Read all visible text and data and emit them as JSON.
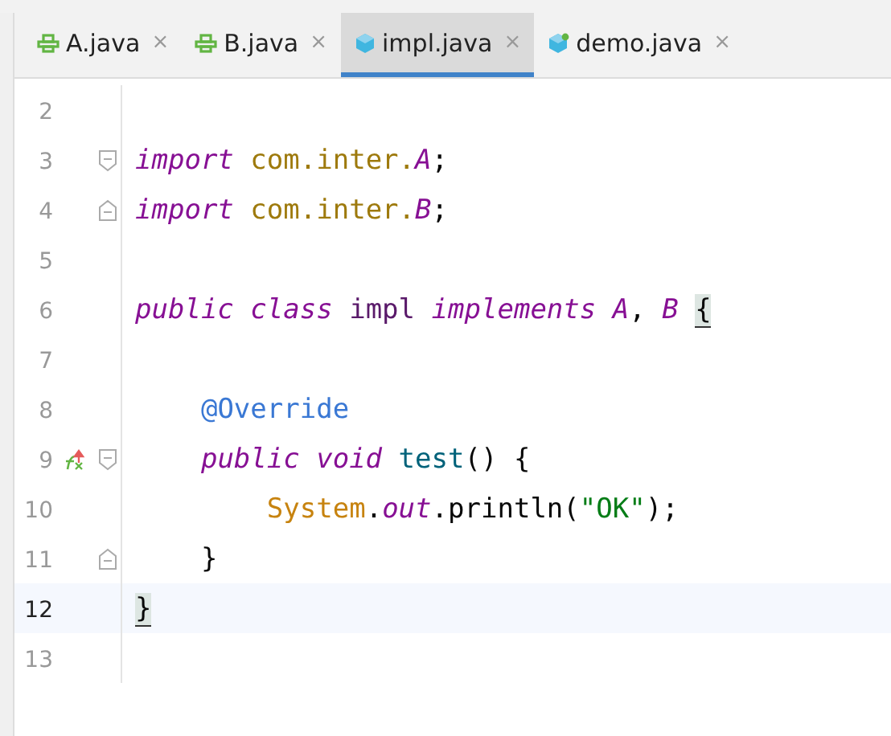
{
  "tabs": [
    {
      "label": "A.java",
      "kind": "interface",
      "selected": false
    },
    {
      "label": "B.java",
      "kind": "interface",
      "selected": false
    },
    {
      "label": "impl.java",
      "kind": "class",
      "selected": true
    },
    {
      "label": "demo.java",
      "kind": "runnable",
      "selected": false
    }
  ],
  "close_glyph": "×",
  "lines": [
    {
      "number": "2",
      "current": false
    },
    {
      "number": "3",
      "current": false,
      "fold_start": true,
      "tokens": [
        {
          "kind": "keyword",
          "text": "import "
        },
        {
          "kind": "package",
          "text": "com.inter."
        },
        {
          "kind": "type_ref",
          "text": "A"
        },
        {
          "kind": "plain",
          "text": ";"
        }
      ]
    },
    {
      "number": "4",
      "current": false,
      "fold_end": true,
      "tokens": [
        {
          "kind": "keyword",
          "text": "import "
        },
        {
          "kind": "package",
          "text": "com.inter."
        },
        {
          "kind": "type_ref",
          "text": "B"
        },
        {
          "kind": "plain",
          "text": ";"
        }
      ]
    },
    {
      "number": "5",
      "current": false
    },
    {
      "number": "6",
      "current": false,
      "tokens": [
        {
          "kind": "keyword",
          "text": "public class "
        },
        {
          "kind": "class_name",
          "text": "impl "
        },
        {
          "kind": "keyword",
          "text": "implements "
        },
        {
          "kind": "type_ref",
          "text": "A"
        },
        {
          "kind": "plain",
          "text": ", "
        },
        {
          "kind": "type_ref",
          "text": "B "
        },
        {
          "kind": "brace_match",
          "text": "{"
        }
      ]
    },
    {
      "number": "7",
      "current": false
    },
    {
      "number": "8",
      "current": false,
      "tokens": [
        {
          "kind": "annotation",
          "text": "    @Override"
        }
      ]
    },
    {
      "number": "9",
      "current": false,
      "fold_start": true,
      "override_marker": true,
      "tokens": [
        {
          "kind": "keyword",
          "text": "    public void "
        },
        {
          "kind": "method",
          "text": "test"
        },
        {
          "kind": "plain",
          "text": "() {"
        }
      ]
    },
    {
      "number": "10",
      "current": false,
      "tokens": [
        {
          "kind": "system",
          "text": "        System"
        },
        {
          "kind": "plain",
          "text": "."
        },
        {
          "kind": "field",
          "text": "out"
        },
        {
          "kind": "plain",
          "text": ".println("
        },
        {
          "kind": "string",
          "text": "\"OK\""
        },
        {
          "kind": "plain",
          "text": ");"
        }
      ]
    },
    {
      "number": "11",
      "current": false,
      "fold_end": true,
      "tokens": [
        {
          "kind": "plain",
          "text": "    }"
        }
      ]
    },
    {
      "number": "12",
      "current": true,
      "tokens": [
        {
          "kind": "brace_match",
          "text": "}"
        }
      ]
    },
    {
      "number": "13",
      "current": false
    }
  ]
}
